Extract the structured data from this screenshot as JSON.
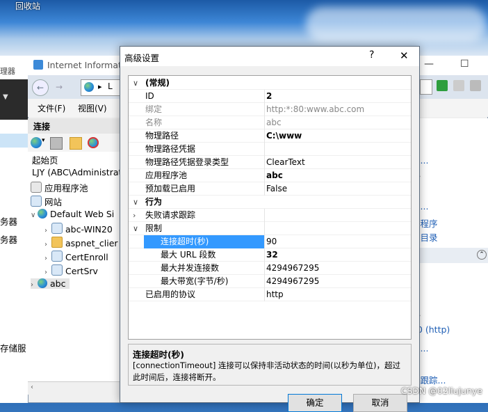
{
  "desktop": {
    "top_label": "回收站"
  },
  "left_window": {
    "items": [
      "理器",
      "务器",
      "务器",
      "存储服"
    ]
  },
  "iis": {
    "title": "Internet Informati",
    "address_fragment": "L",
    "menu": [
      "文件(F)",
      "视图(V)"
    ],
    "left_header": "连接",
    "tree": [
      {
        "label": "起始页",
        "icon": "home-icon"
      },
      {
        "label": "LJY (ABC\\Administrato",
        "icon": "server-icon"
      },
      {
        "label": "应用程序池",
        "icon": "app-pool-icon"
      },
      {
        "label": "网站",
        "icon": "folder-icon"
      },
      {
        "label": "Default Web Si",
        "icon": "globe-icon"
      },
      {
        "label": "abc-WIN20",
        "icon": "app-icon"
      },
      {
        "label": "aspnet_clier",
        "icon": "folder-icon"
      },
      {
        "label": "CertEnroll",
        "icon": "folder-icon"
      },
      {
        "label": "CertSrv",
        "icon": "app-icon"
      },
      {
        "label": "abc",
        "icon": "globe-icon"
      }
    ],
    "right_panel": [
      "限...",
      "站",
      "置...",
      "用程序",
      "以目录",
      "动",
      "站",
      "30 (http)",
      "置...",
      "求跟踪..."
    ]
  },
  "dialog": {
    "title": "高级设置",
    "help": "?",
    "close": "✕",
    "rows": [
      {
        "key": "(常规)",
        "value": "",
        "type": "category",
        "twisty": "∨"
      },
      {
        "key": "ID",
        "value": "2",
        "value_style": "bold"
      },
      {
        "key": "绑定",
        "value": "http:*:80:www.abc.com",
        "value_style": "grey",
        "key_style": "grey"
      },
      {
        "key": "名称",
        "value": "abc",
        "value_style": "grey",
        "key_style": "grey"
      },
      {
        "key": "物理路径",
        "value": "C:\\www",
        "value_style": "bold"
      },
      {
        "key": "物理路径凭据",
        "value": ""
      },
      {
        "key": "物理路径凭据登录类型",
        "value": "ClearText"
      },
      {
        "key": "应用程序池",
        "value": "abc",
        "value_style": "bold"
      },
      {
        "key": "预加载已启用",
        "value": "False"
      },
      {
        "key": "行为",
        "value": "",
        "type": "category",
        "twisty": "∨"
      },
      {
        "key": "失败请求跟踪",
        "value": "",
        "twisty": "›"
      },
      {
        "key": "限制",
        "value": "",
        "twisty": "∨"
      },
      {
        "key": "连接超时(秒)",
        "value": "90",
        "indent": true,
        "selected": true
      },
      {
        "key": "最大 URL 段数",
        "value": "32",
        "indent": true,
        "value_style": "bold"
      },
      {
        "key": "最大并发连接数",
        "value": "4294967295",
        "indent": true
      },
      {
        "key": "最大带宽(字节/秒)",
        "value": "4294967295",
        "indent": true
      },
      {
        "key": "已启用的协议",
        "value": "http"
      }
    ],
    "desc_title": "连接超时(秒)",
    "desc_text_1": "[connectionTimeout] 连接可以保持非活动状态的时间(以秒为单位)，超过",
    "desc_text_2": "此时间后，连接将断开。",
    "ok_label": "确定",
    "cancel_label": "取消"
  },
  "watermark": "CSDN @02liujunye"
}
